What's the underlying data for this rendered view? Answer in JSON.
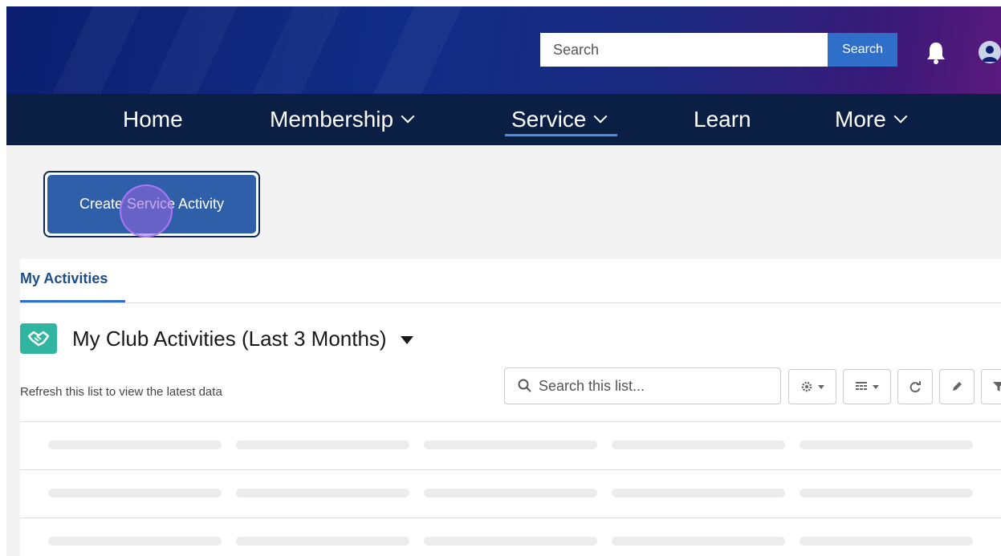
{
  "header": {
    "search_placeholder": "Search",
    "search_button": "Search",
    "icons": [
      "bell-icon",
      "user-avatar-icon"
    ]
  },
  "nav": {
    "items": [
      {
        "label": "Home",
        "dropdown": false
      },
      {
        "label": "Membership",
        "dropdown": true
      },
      {
        "label": "Service",
        "dropdown": true,
        "active": true
      },
      {
        "label": "Learn",
        "dropdown": false
      },
      {
        "label": "More",
        "dropdown": true
      }
    ]
  },
  "actions": {
    "create_button": "Create Service Activity"
  },
  "tabs": {
    "active": "My Activities"
  },
  "list": {
    "title": "My Club Activities (Last 3 Months)",
    "status": "Refresh this list to view the latest data",
    "search_placeholder": "Search this list...",
    "toolbar_icons": [
      "gear-icon",
      "table-view-icon",
      "refresh-icon",
      "edit-icon",
      "filter-icon"
    ]
  },
  "colors": {
    "header_start": "#0c1f70",
    "header_end": "#5a1a7c",
    "nav_bg": "#0b1f45",
    "button_bg": "#2f5fa8",
    "accent": "#2f6fc9",
    "list_icon_bg": "#2fb5a1"
  }
}
